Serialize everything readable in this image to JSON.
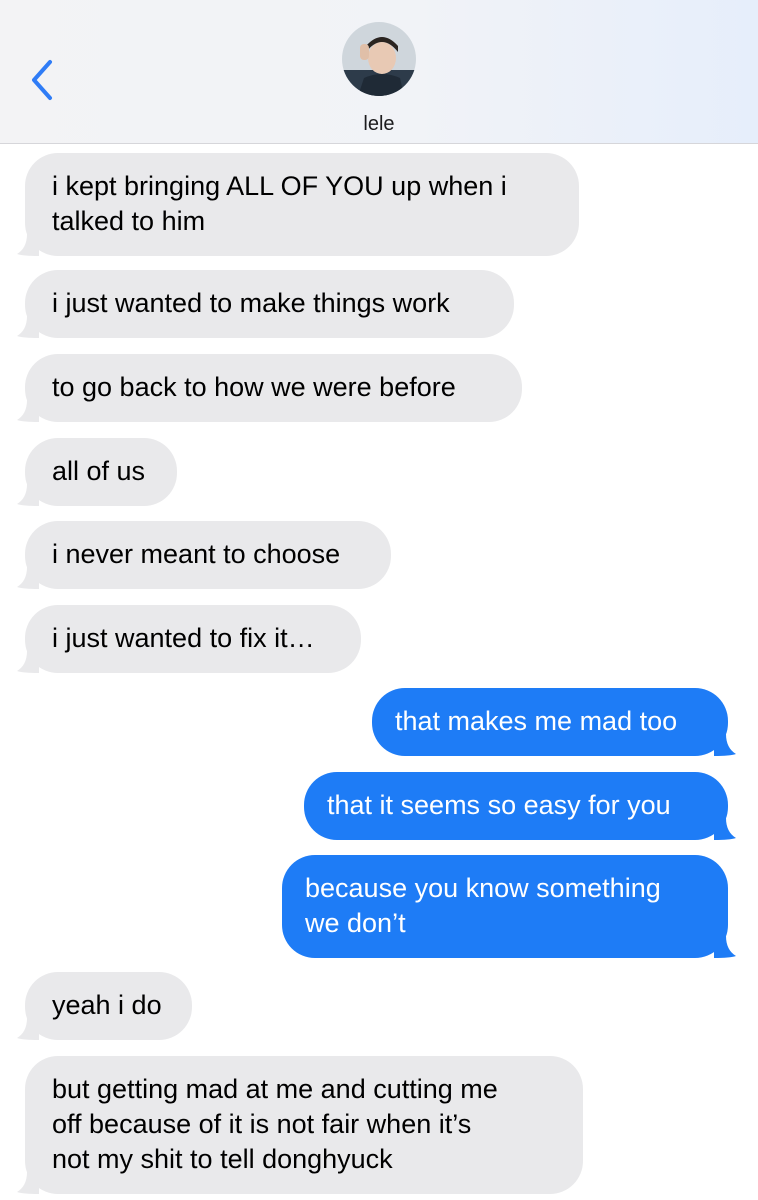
{
  "header": {
    "contact_name": "lele"
  },
  "messages": [
    {
      "dir": "in",
      "text": "i kept bringing ALL OF YOU up when i\ntalked to him"
    },
    {
      "dir": "in",
      "text": "i just wanted to make things work"
    },
    {
      "dir": "in",
      "text": "to go back to how we were before"
    },
    {
      "dir": "in",
      "text": "all of us"
    },
    {
      "dir": "in",
      "text": "i never meant to choose"
    },
    {
      "dir": "in",
      "text": "i just wanted to fix it…"
    },
    {
      "dir": "out",
      "text": "that makes me mad too"
    },
    {
      "dir": "out",
      "text": "that it seems so easy for you"
    },
    {
      "dir": "out",
      "text": "because you know something\nwe don’t"
    },
    {
      "dir": "in",
      "text": "yeah i do"
    },
    {
      "dir": "in",
      "text": "but getting mad at me and cutting me\noff because of it is not fair when it’s\nnot my shit to tell donghyuck"
    }
  ],
  "colors": {
    "incoming_bubble": "#e9e9eb",
    "outgoing_bubble": "#1e7cf6",
    "accent": "#2f7cf6"
  }
}
